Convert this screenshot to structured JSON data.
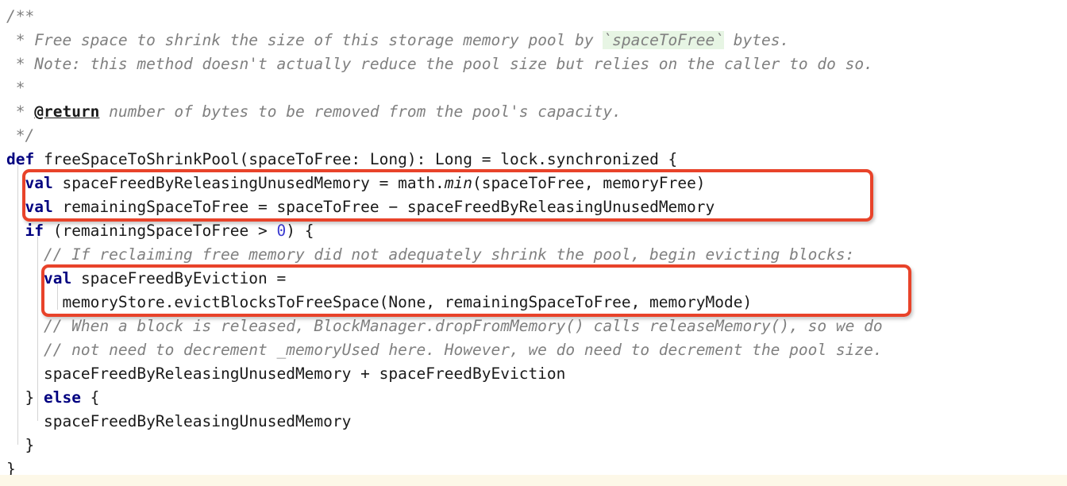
{
  "editor": {
    "language": "scala",
    "background": "#ffffff",
    "annotation_color": "#e8432a",
    "comment_color": "#808080",
    "keyword_color": "#000080",
    "number_color": "#3b3bd0",
    "highlight_background": "#e7f5e4",
    "bottom_strip_color": "#fdf8e8"
  },
  "lines": {
    "l1": "/**",
    "l2_star": " * ",
    "l2_a": "Free space to shrink the size of this storage memory pool by ",
    "l2_code": "`spaceToFree`",
    "l2_b": " bytes.",
    "l3": " * Note: this method doesn't actually reduce the pool size but relies on the caller to do so.",
    "l4": " *",
    "l5_star": " * ",
    "l5_tag": "@return",
    "l5_text": " number of bytes to be removed from the pool's capacity.",
    "l6": " */",
    "l7_kw": "def",
    "l7_rest": " freeSpaceToShrinkPool(spaceToFree: Long): Long = lock.synchronized {",
    "l8_indent": "  ",
    "l8_kw": "val",
    "l8_a": " spaceFreedByReleasingUnusedMemory = math.",
    "l8_mth": "min",
    "l8_b": "(spaceToFree, memoryFree)",
    "l9_indent": "  ",
    "l9_kw": "val",
    "l9_rest": " remainingSpaceToFree = spaceToFree − spaceFreedByReleasingUnusedMemory",
    "l10_indent": "  ",
    "l10_kw": "if",
    "l10_a": " (remainingSpaceToFree > ",
    "l10_num": "0",
    "l10_b": ") {",
    "l11": "    // If reclaiming free memory did not adequately shrink the pool, begin evicting blocks:",
    "l12_indent": "    ",
    "l12_kw": "val",
    "l12_rest": " spaceFreedByEviction =",
    "l13": "      memoryStore.evictBlocksToFreeSpace(None, remainingSpaceToFree, memoryMode)",
    "l14": "    // When a block is released, BlockManager.dropFromMemory() calls releaseMemory(), so we do",
    "l15": "    // not need to decrement _memoryUsed here. However, we do need to decrement the pool size.",
    "l16": "    spaceFreedByReleasingUnusedMemory + spaceFreedByEviction",
    "l17_a": "  } ",
    "l17_kw": "else",
    "l17_b": " {",
    "l18": "    spaceFreedByReleasingUnusedMemory",
    "l19": "  }",
    "l20": "}"
  },
  "annotations": [
    {
      "name": "annotation-box-1",
      "label": "red-rectangle-highlight-val-lines"
    },
    {
      "name": "annotation-box-2",
      "label": "red-rectangle-highlight-eviction-lines"
    }
  ]
}
